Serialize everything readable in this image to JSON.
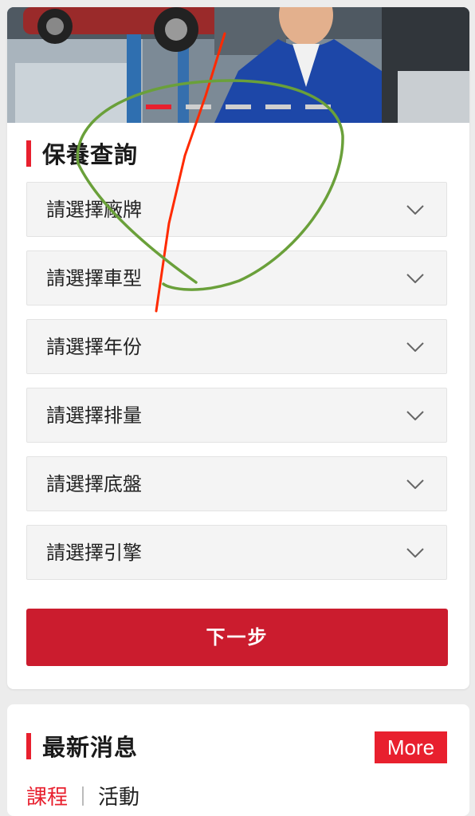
{
  "maintenance": {
    "title": "保養查詢",
    "selects": [
      {
        "label": "請選擇廠牌"
      },
      {
        "label": "請選擇車型"
      },
      {
        "label": "請選擇年份"
      },
      {
        "label": "請選擇排量"
      },
      {
        "label": "請選擇底盤"
      },
      {
        "label": "請選擇引擎"
      }
    ],
    "next_label": "下一步"
  },
  "banner": {
    "active_slide": 1,
    "slide_count": 5
  },
  "news": {
    "title": "最新消息",
    "more_label": "More",
    "tabs": [
      {
        "label": "課程",
        "active": true
      },
      {
        "label": "活動",
        "active": false
      }
    ]
  },
  "colors": {
    "accent": "#e8202e",
    "button": "#cb1c2e"
  }
}
